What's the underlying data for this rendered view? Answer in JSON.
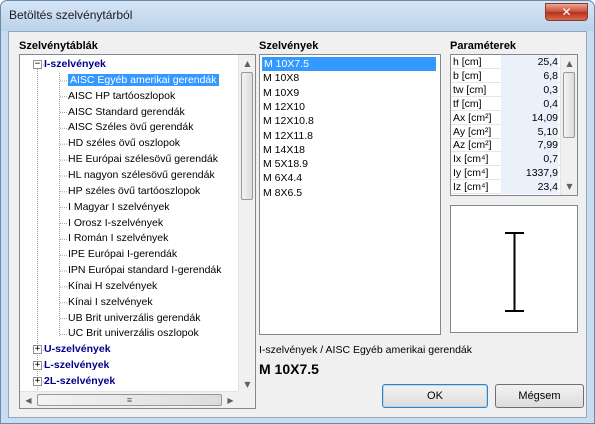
{
  "window": {
    "title": "Betöltés szelvénytárból",
    "close_glyph": "✕"
  },
  "labels": {
    "tables": "Szelvénytáblák",
    "sections": "Szelvények",
    "params": "Paraméterek"
  },
  "tree": {
    "groups": [
      {
        "label": "I-szelvények",
        "expander": "−"
      },
      {
        "label": "U-szelvények",
        "expander": "+"
      },
      {
        "label": "L-szelvények",
        "expander": "+"
      },
      {
        "label": "2L-szelvények",
        "expander": "+"
      }
    ],
    "items": [
      "AISC Egyéb amerikai gerendák",
      "AISC HP tartóoszlopok",
      "AISC Standard gerendák",
      "AISC Széles övű gerendák",
      "HD  széles övű oszlopok",
      "HE  Európai szélesövű gerendák",
      "HL  nagyon szélesövű gerendák",
      "HP  széles övű tartóoszlopok",
      "I   Magyar I szelvények",
      "I   Orosz I-szelvények",
      "I   Román I szelvények",
      "IPE Európai I-gerendák",
      "IPN Európai standard I-gerendák",
      "Kínai H szelvények",
      "Kínai I szelvények",
      "UB  Brit univerzális gerendák",
      "UC  Brit univerzális oszlopok"
    ],
    "selected_index": 0
  },
  "sections": {
    "items": [
      "M 10X7.5",
      "M 10X8",
      "M 10X9",
      "M 12X10",
      "M 12X10.8",
      "M 12X11.8",
      "M 14X18",
      "M 5X18.9",
      "M 6X4.4",
      "M 8X6.5"
    ],
    "selected_index": 0
  },
  "params": [
    {
      "name": "h [cm]",
      "value": "25,4"
    },
    {
      "name": "b [cm]",
      "value": "6,8"
    },
    {
      "name": "tw [cm]",
      "value": "0,3"
    },
    {
      "name": "tf [cm]",
      "value": "0,4"
    },
    {
      "name": "Ax [cm²]",
      "value": "14,09"
    },
    {
      "name": "Ay [cm²]",
      "value": "5,10"
    },
    {
      "name": "Az [cm²]",
      "value": "7,99"
    },
    {
      "name": "Ix [cm⁴]",
      "value": "0,7"
    },
    {
      "name": "Iy [cm⁴]",
      "value": "1337,9"
    },
    {
      "name": "Iz [cm⁴]",
      "value": "23,4"
    }
  ],
  "path": "I-szelvények / AISC Egyéb amerikai gerendák",
  "current_section": "M 10X7.5",
  "buttons": {
    "ok": "OK",
    "cancel": "Mégsem"
  },
  "colors": {
    "selection": "#3399ff",
    "group_text": "#00008b",
    "close_button": "#c94a37"
  },
  "scroll_glyphs": {
    "up": "▲",
    "down": "▼",
    "left": "◀",
    "right": "▶",
    "grip": "≡"
  }
}
